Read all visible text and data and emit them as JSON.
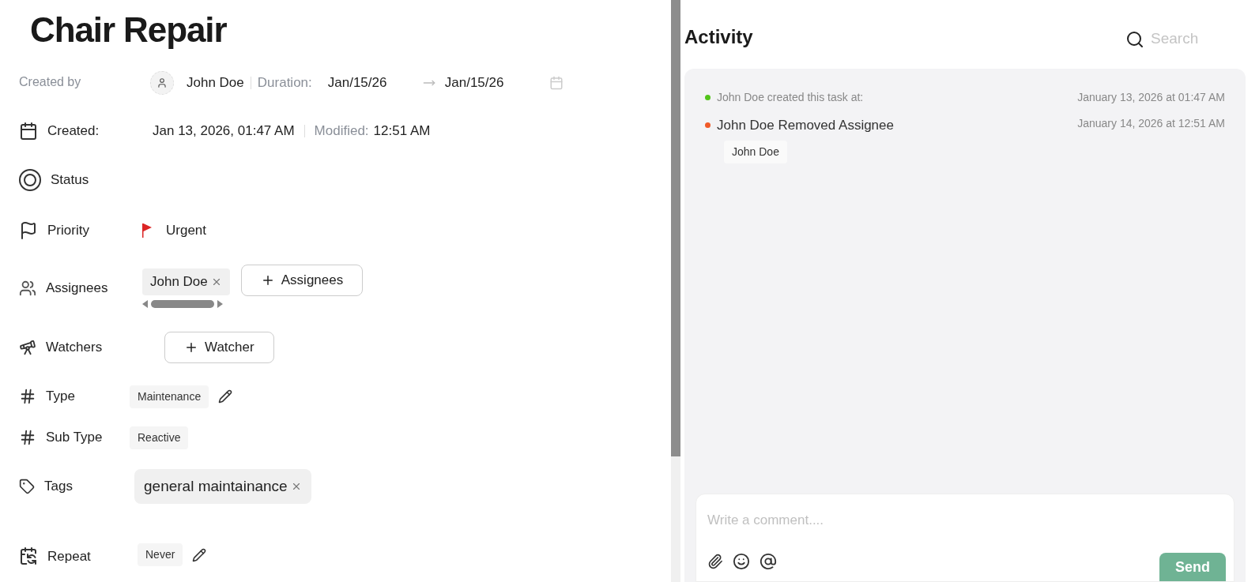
{
  "title": "Chair Repair",
  "fields": [
    {
      "kind": "created_by",
      "label": "Created by",
      "user": "John Doe",
      "duration_label": "Duration:",
      "start": "Jan/15/26",
      "end": "Jan/15/26"
    },
    {
      "kind": "created",
      "label": "Created:",
      "value": "Jan 13, 2026, 01:47 AM",
      "modified_label": "Modified:",
      "modified": "12:51 AM"
    },
    {
      "kind": "status",
      "label": "Status"
    },
    {
      "kind": "priority",
      "label": "Priority",
      "value": "Urgent",
      "color": "#dc2626"
    },
    {
      "kind": "assignees",
      "label": "Assignees",
      "chips": [
        "John Doe"
      ],
      "button": "Assignees"
    },
    {
      "kind": "watchers",
      "label": "Watchers",
      "button": "Watcher"
    },
    {
      "kind": "type",
      "label": "Type",
      "value": "Maintenance",
      "editable": true
    },
    {
      "kind": "subtype",
      "label": "Sub Type",
      "value": "Reactive",
      "editable": false
    },
    {
      "kind": "tags",
      "label": "Tags",
      "chips": [
        "general maintainance"
      ]
    },
    {
      "kind": "repeat",
      "label": "Repeat",
      "value": "Never",
      "editable": true
    }
  ],
  "activity": {
    "title": "Activity",
    "search": {
      "placeholder": "Search"
    },
    "items": [
      {
        "text": "John Doe created this task at:",
        "time": "January 13, 2026 at 01:47 AM",
        "color": "#52c41a",
        "emphasis": false
      },
      {
        "text": "John Doe Removed Assignee",
        "time": "January 14, 2026 at 12:51 AM",
        "color": "#f05a28",
        "emphasis": true,
        "chip": "John Doe"
      }
    ],
    "comment": {
      "placeholder": "Write a comment....",
      "send": "Send"
    }
  }
}
